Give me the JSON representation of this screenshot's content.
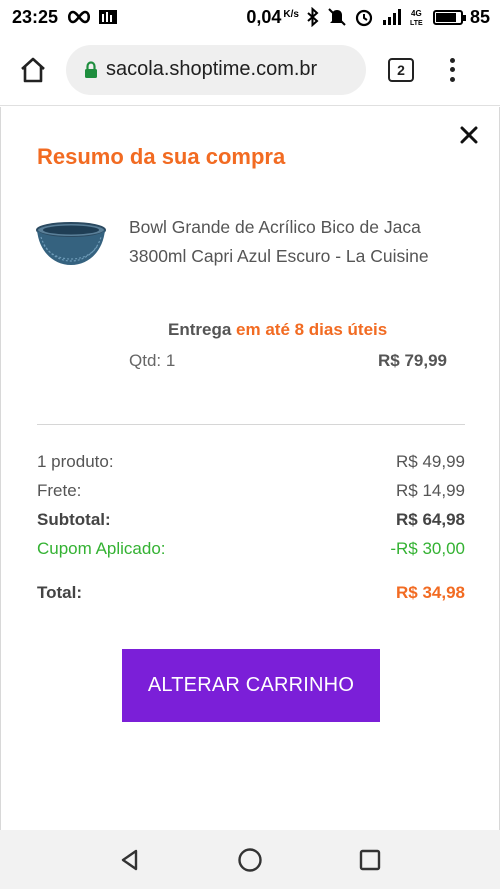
{
  "status_bar": {
    "time": "23:25",
    "net_speed": "0,04",
    "net_speed_unit": "K/s",
    "battery": "85"
  },
  "browser": {
    "url": "sacola.shoptime.com.br",
    "tab_count": "2"
  },
  "modal": {
    "title": "Resumo da sua compra",
    "product": {
      "name": "Bowl Grande de Acrílico Bico de Jaca 3800ml Capri Azul Escuro - La Cuisine",
      "delivery_prefix": "Entrega ",
      "delivery_highlight": "em até 8 dias úteis",
      "qty": "Qtd: 1",
      "price": "R$ 79,99"
    },
    "summary": {
      "products_label": "1 produto:",
      "products_value": "R$ 49,99",
      "shipping_label": "Frete:",
      "shipping_value": "R$ 14,99",
      "subtotal_label": "Subtotal:",
      "subtotal_value": "R$ 64,98",
      "coupon_label": "Cupom Aplicado:",
      "coupon_value": "-R$ 30,00",
      "total_label": "Total:",
      "total_value": "R$ 34,98"
    },
    "cta_label": "ALTERAR CARRINHO"
  },
  "colors": {
    "accent_orange": "#f26b22",
    "cta_purple": "#7b1fd8",
    "coupon_green": "#34b233"
  },
  "icons": {
    "home": "home-icon",
    "lock": "lock-icon",
    "menu": "more-vert-icon",
    "close": "close-icon",
    "back": "back-triangle-icon",
    "home_nav": "home-circle-icon",
    "recents": "recents-square-icon"
  }
}
